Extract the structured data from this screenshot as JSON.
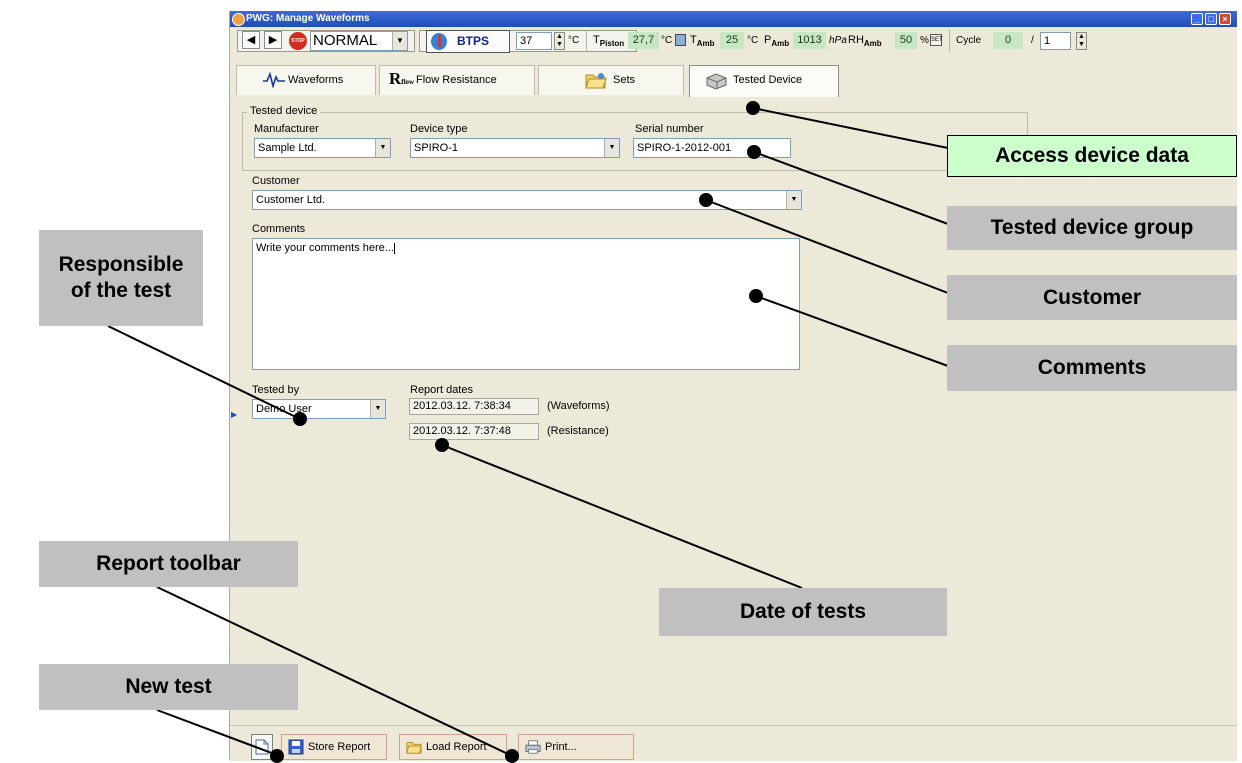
{
  "window": {
    "title": "PWG: Manage Waveforms"
  },
  "toolbar": {
    "mode": "NORMAL",
    "btps_label": "BTPS",
    "temp_value": "37",
    "temp_unit": "°C",
    "t_piston_label": "T",
    "t_piston_sub": "Piston",
    "t_piston_value": "27,7",
    "t_piston_unit": "°C",
    "t_amb_label": "T",
    "t_amb_sub": "Amb",
    "t_amb_value": "25",
    "t_amb_unit": "°C",
    "p_amb_label": "P",
    "p_amb_sub": "Amb",
    "p_amb_value": "1013",
    "p_amb_unit": "hPa",
    "rh_amb_label": "RH",
    "rh_amb_sub": "Amb",
    "rh_amb_value": "50",
    "rh_amb_unit": "%",
    "set_label": "SET",
    "cycle_label": "Cycle",
    "cycle_value": "0",
    "cycle_sep": "/",
    "cycle_total": "1"
  },
  "tabs": [
    {
      "label": "Waveforms",
      "icon": "waveform-icon"
    },
    {
      "label": "Flow Resistance",
      "icon": "rflow-icon"
    },
    {
      "label": "Sets",
      "icon": "folder-icon"
    },
    {
      "label": "Tested Device",
      "icon": "device-icon"
    }
  ],
  "form": {
    "group_title": "Tested device",
    "manufacturer_label": "Manufacturer",
    "manufacturer_value": "Sample Ltd.",
    "device_type_label": "Device type",
    "device_type_value": "SPIRO-1",
    "serial_label": "Serial number",
    "serial_value": "SPIRO-1-2012-001",
    "customer_label": "Customer",
    "customer_value": "Customer Ltd.",
    "comments_label": "Comments",
    "comments_value": "Write your comments here...",
    "tested_by_label": "Tested by",
    "tested_by_value": "Demo User",
    "report_dates_label": "Report dates",
    "date_waveforms": "2012.03.12. 7:38:34",
    "date_waveforms_label": "(Waveforms)",
    "date_resistance": "2012.03.12. 7:37:48",
    "date_resistance_label": "(Resistance)"
  },
  "bottom_bar": {
    "store_label": "Store Report",
    "load_label": "Load Report",
    "print_label": "Print..."
  },
  "callouts": {
    "access_device_data": "Access device data",
    "tested_device_group": "Tested device group",
    "customer": "Customer",
    "comments": "Comments",
    "responsible_line1": "Responsible",
    "responsible_line2": "of the test",
    "report_toolbar": "Report toolbar",
    "date_of_tests": "Date of tests",
    "new_test": "New test"
  },
  "colors": {
    "window_bg": "#ece9d8",
    "callout_gray": "#c0c0c0",
    "callout_green": "#ccffcc",
    "value_green": "#c6e7c2"
  }
}
